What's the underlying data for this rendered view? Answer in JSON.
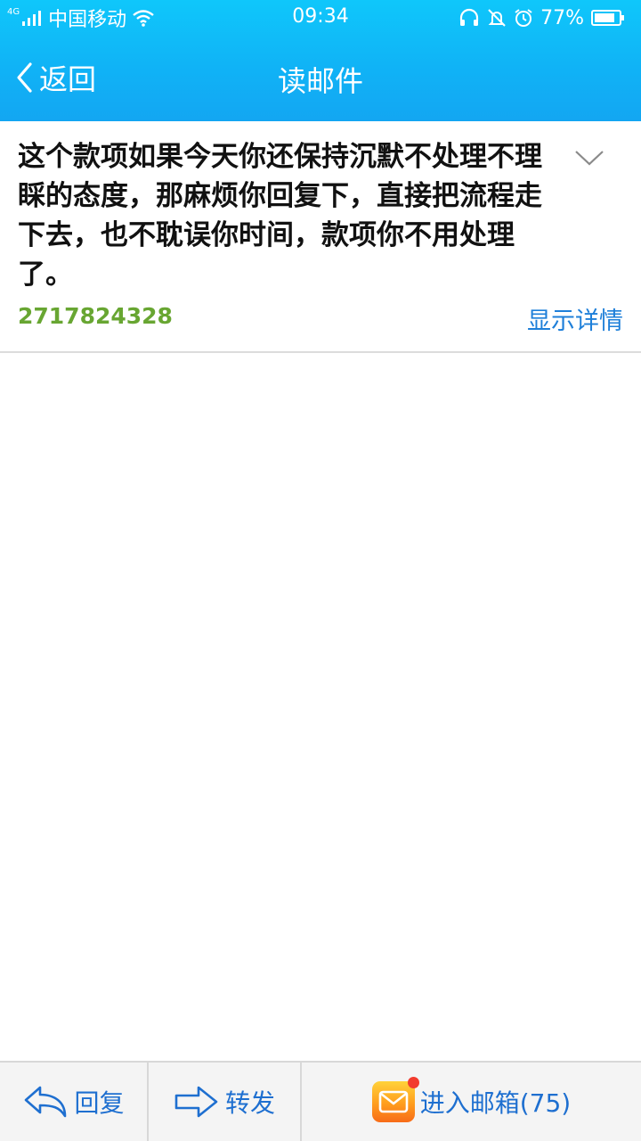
{
  "status_bar": {
    "network": "4G",
    "carrier": "中国移动",
    "time": "09:34",
    "battery": "77%",
    "icons": [
      "signal-icon",
      "wifi-icon",
      "headset-icon",
      "mute-icon",
      "alarm-icon",
      "battery-icon"
    ]
  },
  "nav": {
    "back_label": "返回",
    "title": "读邮件"
  },
  "mail": {
    "subject": "这个款项如果今天你还保持沉默不处理不理睬的态度，那麻烦你回复下，直接把流程走下去，也不耽误你时间，款项你不用处理了。",
    "sender": "2717824328",
    "details_label": "显示详情"
  },
  "toolbar": {
    "reply_label": "回复",
    "forward_label": "转发",
    "inbox_label": "进入邮箱(75)"
  },
  "colors": {
    "header_gradient_top": "#0fc7fb",
    "header_gradient_bottom": "#13a6f2",
    "sender": "#68a632",
    "link": "#1e7fd9",
    "toolbar_text": "#1e6fd0",
    "badge": "#f23b2e"
  }
}
